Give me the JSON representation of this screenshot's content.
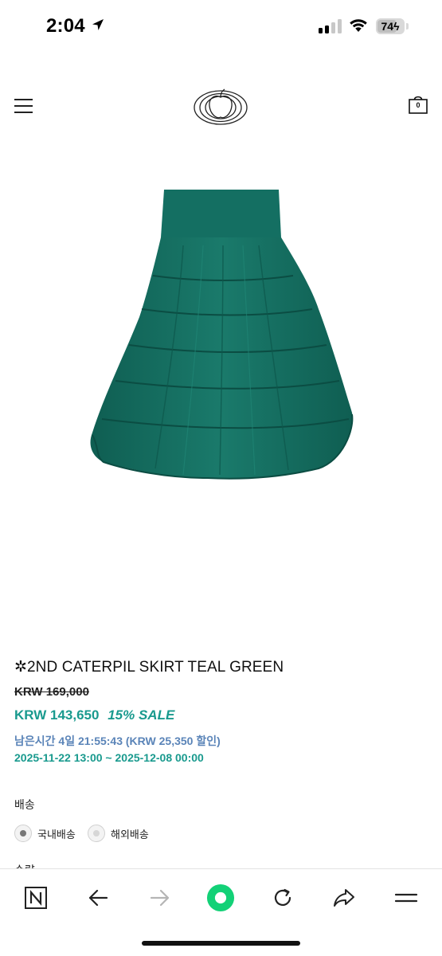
{
  "status_bar": {
    "time": "2:04",
    "battery_level": "74",
    "battery_fraction": 0.74,
    "icons": [
      "location-arrow-icon",
      "cellular-signal-icon",
      "wifi-icon",
      "battery-charging-icon"
    ]
  },
  "header": {
    "menu_icon": "hamburger-menu-icon",
    "logo_icon": "apple-ring-logo",
    "cart_icon": "shopping-bag-icon",
    "cart_count": "0"
  },
  "product": {
    "image_icon": "teal-tiered-skirt-image",
    "title": "✲2ND CATERPIL SKIRT TEAL GREEN",
    "original_price": "KRW 169,000",
    "sale_price": "KRW 143,650",
    "sale_badge": "15% SALE",
    "countdown": "남은시간 4일 21:55:43 (KRW 25,350 할인)",
    "sale_period": "2025-11-22 13:00 ~ 2025-12-08 00:00"
  },
  "shipping": {
    "label": "배송",
    "options": [
      {
        "label": "국내배송",
        "selected": true
      },
      {
        "label": "해외배송",
        "selected": false
      }
    ]
  },
  "quantity": {
    "label_partial": "수량"
  },
  "toolbar": {
    "buttons": [
      "naver-n-icon",
      "back-arrow-icon",
      "forward-arrow-icon",
      "green-home-dot-icon",
      "reload-icon",
      "share-icon",
      "menu-lines-icon"
    ]
  },
  "colors": {
    "accent_sale": "#199a8e",
    "countdown_blue": "#5a84b8",
    "skirt_teal": "#136b5e",
    "home_green": "#13d177"
  }
}
